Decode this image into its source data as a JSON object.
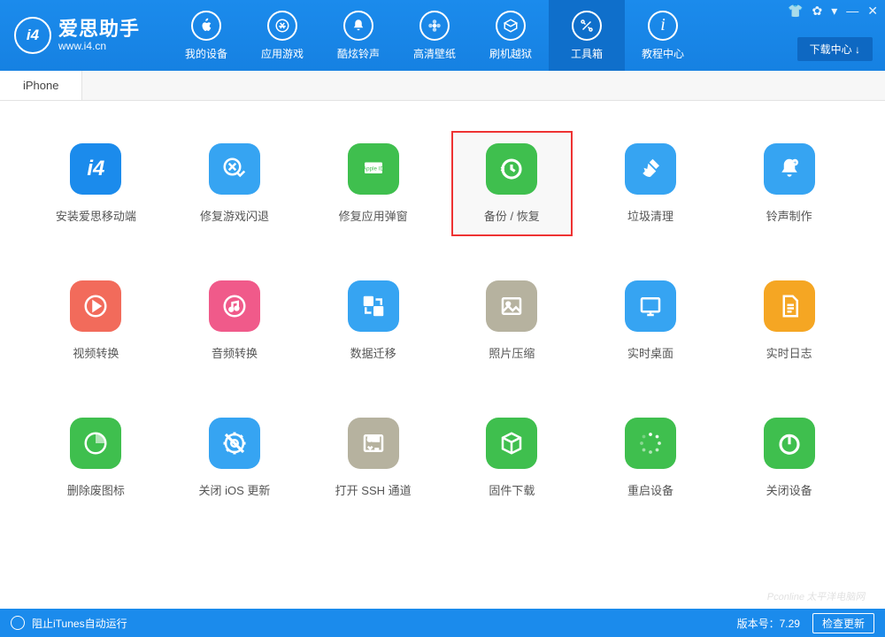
{
  "brand": {
    "logo": "i4",
    "cn": "爱思助手",
    "en": "www.i4.cn"
  },
  "nav": [
    {
      "label": "我的设备"
    },
    {
      "label": "应用游戏"
    },
    {
      "label": "酷炫铃声"
    },
    {
      "label": "高清壁纸"
    },
    {
      "label": "刷机越狱"
    },
    {
      "label": "工具箱"
    },
    {
      "label": "教程中心"
    }
  ],
  "downloadCenter": "下载中心 ↓",
  "tabs": [
    "iPhone"
  ],
  "tools": [
    {
      "label": "安装爱思移动端",
      "bg": "#1b8bec",
      "icon": "i4"
    },
    {
      "label": "修复游戏闪退",
      "bg": "#36a4f2",
      "icon": "appstore-check"
    },
    {
      "label": "修复应用弹窗",
      "bg": "#3fbf4e",
      "icon": "apple-id"
    },
    {
      "label": "备份 / 恢复",
      "bg": "#3fbf4e",
      "icon": "restore",
      "highlight": true
    },
    {
      "label": "垃圾清理",
      "bg": "#36a4f2",
      "icon": "broom"
    },
    {
      "label": "铃声制作",
      "bg": "#36a4f2",
      "icon": "bell"
    },
    {
      "label": "视频转换",
      "bg": "#f26b5b",
      "icon": "play"
    },
    {
      "label": "音频转换",
      "bg": "#f05a8a",
      "icon": "music"
    },
    {
      "label": "数据迁移",
      "bg": "#36a4f2",
      "icon": "transfer"
    },
    {
      "label": "照片压缩",
      "bg": "#b6b29f",
      "icon": "photo"
    },
    {
      "label": "实时桌面",
      "bg": "#36a4f2",
      "icon": "screen"
    },
    {
      "label": "实时日志",
      "bg": "#f5a623",
      "icon": "doc"
    },
    {
      "label": "删除废图标",
      "bg": "#3fbf4e",
      "icon": "pie"
    },
    {
      "label": "关闭 iOS 更新",
      "bg": "#36a4f2",
      "icon": "gear-off"
    },
    {
      "label": "打开 SSH 通道",
      "bg": "#b6b29f",
      "icon": "ssh"
    },
    {
      "label": "固件下载",
      "bg": "#3fbf4e",
      "icon": "cube"
    },
    {
      "label": "重启设备",
      "bg": "#3fbf4e",
      "icon": "loading"
    },
    {
      "label": "关闭设备",
      "bg": "#3fbf4e",
      "icon": "power"
    }
  ],
  "footer": {
    "left": "阻止iTunes自动运行",
    "version": "版本号：7.29",
    "update": "检查更新"
  },
  "watermark": "Pconline\n太平洋电脑网"
}
